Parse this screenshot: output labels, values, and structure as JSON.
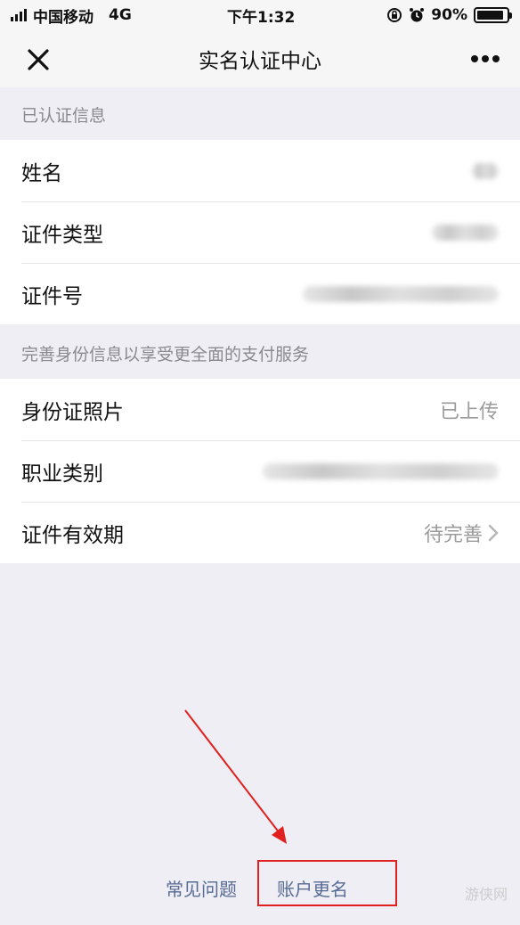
{
  "status_bar": {
    "carrier": "中国移动",
    "network": "4G",
    "time": "下午1:32",
    "battery": "90%",
    "battery_level": 0.9
  },
  "nav": {
    "title": "实名认证中心"
  },
  "verified_section": {
    "header": "已认证信息",
    "rows": [
      {
        "label": "姓名"
      },
      {
        "label": "证件类型"
      },
      {
        "label": "证件号"
      }
    ]
  },
  "complete_section": {
    "header": "完善身份信息以享受更全面的支付服务",
    "rows": [
      {
        "label": "身份证照片",
        "value": "已上传"
      },
      {
        "label": "职业类别"
      },
      {
        "label": "证件有效期",
        "value": "待完善"
      }
    ]
  },
  "footer": {
    "faq": "常见问题",
    "rename": "账户更名"
  },
  "watermark": "游侠网",
  "colors": {
    "link": "#576b95",
    "annotation": "#e0211f",
    "background": "#efeef4"
  }
}
